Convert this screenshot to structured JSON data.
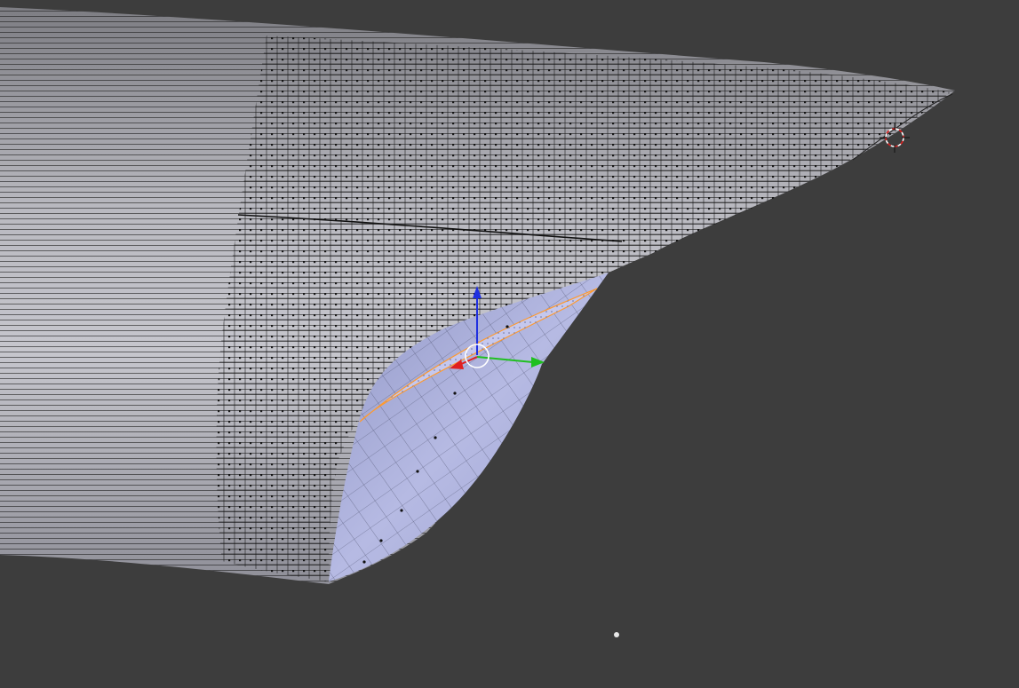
{
  "viewport": {
    "background_color": "#3d3d3d"
  },
  "mesh": {
    "body_color": "#8e8e95",
    "body_highlight_color": "#c4c4cc",
    "wire_color": "#111111",
    "face_color": "#a9aed8",
    "face_highlight_color": "#c8cbea",
    "selected_edge_color": "#ff9a2e"
  },
  "manipulator": {
    "x_axis_color": "#e02020",
    "y_axis_color": "#20c020",
    "z_axis_color": "#2030e0",
    "origin_icon": "pivot-circle-icon"
  },
  "cursor_3d": {
    "icon": "3d-cursor-icon",
    "ring_colors": [
      "#e02020",
      "#ffffff"
    ]
  }
}
